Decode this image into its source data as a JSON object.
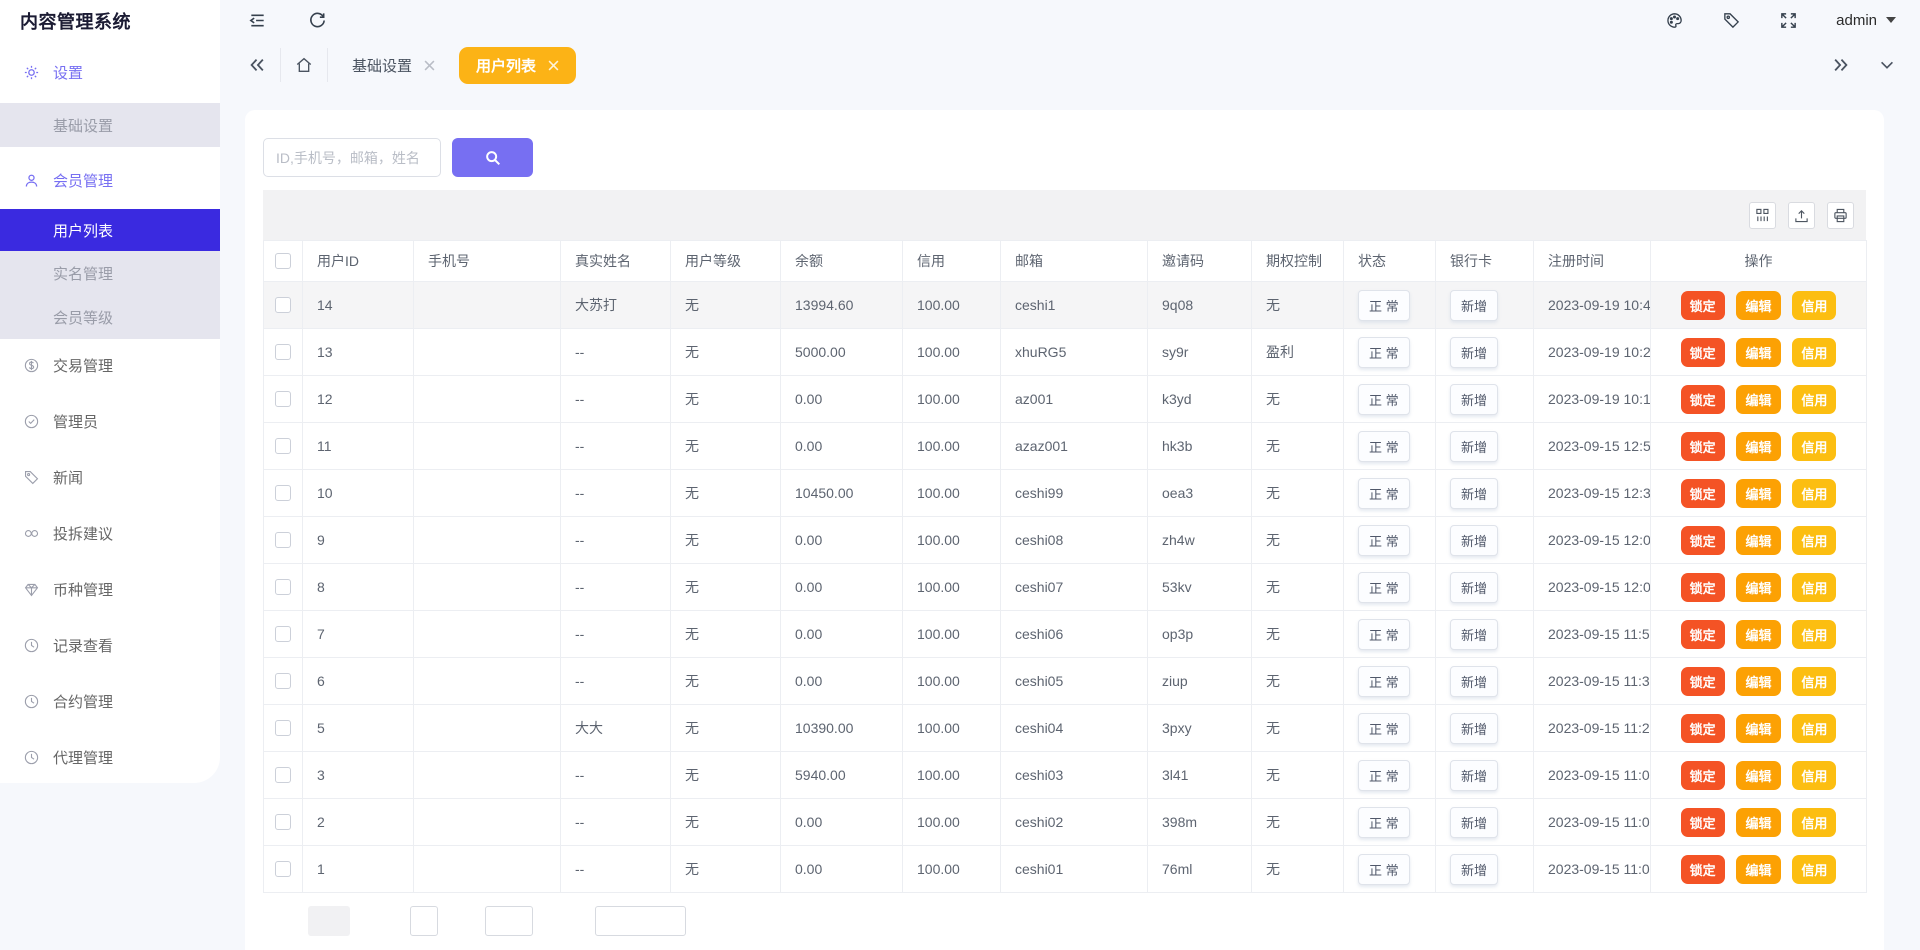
{
  "app": {
    "title": "内容管理系统"
  },
  "topbar": {
    "icons": [
      "menu-fold-icon",
      "refresh-icon",
      "palette-icon",
      "tag-icon",
      "fullscreen-icon"
    ],
    "user": "admin"
  },
  "tabs": {
    "collapse_icon": "double-chevron-left",
    "home_icon": "home-icon",
    "items": [
      {
        "label": "基础设置",
        "active": false
      },
      {
        "label": "用户列表",
        "active": true
      }
    ],
    "more_icon": "double-chevron-right",
    "dropdown_icon": "chevron-down"
  },
  "sidebar": {
    "items": [
      {
        "label": "设置",
        "icon": "gear-icon"
      },
      {
        "label": "基础设置"
      },
      {
        "label": "会员管理",
        "icon": "user-icon"
      },
      {
        "label": "用户列表",
        "selected": true
      },
      {
        "label": "实名管理"
      },
      {
        "label": "会员等级"
      },
      {
        "label": "交易管理",
        "icon": "dollar-icon"
      },
      {
        "label": "管理员",
        "icon": "shield-check-icon"
      },
      {
        "label": "新闻",
        "icon": "tag-icon"
      },
      {
        "label": "投拆建议",
        "icon": "link-icon"
      },
      {
        "label": "币种管理",
        "icon": "gem-icon"
      },
      {
        "label": "记录查看",
        "icon": "clock-icon"
      },
      {
        "label": "合约管理",
        "icon": "clock-icon"
      },
      {
        "label": "代理管理",
        "icon": "clock-icon"
      }
    ]
  },
  "search": {
    "placeholder": "ID,手机号，邮箱，姓名"
  },
  "table": {
    "toolbar_icons": [
      "columns-icon",
      "export-icon",
      "print-icon"
    ],
    "headers": [
      "用户ID",
      "手机号",
      "真实姓名",
      "用户等级",
      "余额",
      "信用",
      "邮箱",
      "邀请码",
      "期权控制",
      "状态",
      "银行卡",
      "注册时间",
      "操作"
    ],
    "actions": [
      "锁定",
      "编辑",
      "信用"
    ],
    "rows": [
      {
        "user_id": "14",
        "phone": "",
        "real_name": "大苏打",
        "level": "无",
        "balance": "13994.60",
        "credit": "100.00",
        "email": "ceshi1",
        "invite_code": "9q08",
        "option_control": "无",
        "status": "正 常",
        "bank": "新增",
        "reg_time": "2023-09-19 10:4"
      },
      {
        "user_id": "13",
        "phone": "",
        "real_name": "--",
        "level": "无",
        "balance": "5000.00",
        "credit": "100.00",
        "email": "xhuRG5",
        "invite_code": "sy9r",
        "option_control": "盈利",
        "status": "正 常",
        "bank": "新增",
        "reg_time": "2023-09-19 10:2"
      },
      {
        "user_id": "12",
        "phone": "",
        "real_name": "--",
        "level": "无",
        "balance": "0.00",
        "credit": "100.00",
        "email": "az001",
        "invite_code": "k3yd",
        "option_control": "无",
        "status": "正 常",
        "bank": "新增",
        "reg_time": "2023-09-19 10:1"
      },
      {
        "user_id": "11",
        "phone": "",
        "real_name": "--",
        "level": "无",
        "balance": "0.00",
        "credit": "100.00",
        "email": "azaz001",
        "invite_code": "hk3b",
        "option_control": "无",
        "status": "正 常",
        "bank": "新增",
        "reg_time": "2023-09-15 12:5"
      },
      {
        "user_id": "10",
        "phone": "",
        "real_name": "--",
        "level": "无",
        "balance": "10450.00",
        "credit": "100.00",
        "email": "ceshi99",
        "invite_code": "oea3",
        "option_control": "无",
        "status": "正 常",
        "bank": "新增",
        "reg_time": "2023-09-15 12:3"
      },
      {
        "user_id": "9",
        "phone": "",
        "real_name": "--",
        "level": "无",
        "balance": "0.00",
        "credit": "100.00",
        "email": "ceshi08",
        "invite_code": "zh4w",
        "option_control": "无",
        "status": "正 常",
        "bank": "新增",
        "reg_time": "2023-09-15 12:0"
      },
      {
        "user_id": "8",
        "phone": "",
        "real_name": "--",
        "level": "无",
        "balance": "0.00",
        "credit": "100.00",
        "email": "ceshi07",
        "invite_code": "53kv",
        "option_control": "无",
        "status": "正 常",
        "bank": "新增",
        "reg_time": "2023-09-15 12:0"
      },
      {
        "user_id": "7",
        "phone": "",
        "real_name": "--",
        "level": "无",
        "balance": "0.00",
        "credit": "100.00",
        "email": "ceshi06",
        "invite_code": "op3p",
        "option_control": "无",
        "status": "正 常",
        "bank": "新增",
        "reg_time": "2023-09-15 11:5"
      },
      {
        "user_id": "6",
        "phone": "",
        "real_name": "--",
        "level": "无",
        "balance": "0.00",
        "credit": "100.00",
        "email": "ceshi05",
        "invite_code": "ziup",
        "option_control": "无",
        "status": "正 常",
        "bank": "新增",
        "reg_time": "2023-09-15 11:3"
      },
      {
        "user_id": "5",
        "phone": "",
        "real_name": "大大",
        "level": "无",
        "balance": "10390.00",
        "credit": "100.00",
        "email": "ceshi04",
        "invite_code": "3pxy",
        "option_control": "无",
        "status": "正 常",
        "bank": "新增",
        "reg_time": "2023-09-15 11:2"
      },
      {
        "user_id": "3",
        "phone": "",
        "real_name": "--",
        "level": "无",
        "balance": "5940.00",
        "credit": "100.00",
        "email": "ceshi03",
        "invite_code": "3l41",
        "option_control": "无",
        "status": "正 常",
        "bank": "新增",
        "reg_time": "2023-09-15 11:0"
      },
      {
        "user_id": "2",
        "phone": "",
        "real_name": "--",
        "level": "无",
        "balance": "0.00",
        "credit": "100.00",
        "email": "ceshi02",
        "invite_code": "398m",
        "option_control": "无",
        "status": "正 常",
        "bank": "新增",
        "reg_time": "2023-09-15 11:0"
      },
      {
        "user_id": "1",
        "phone": "",
        "real_name": "--",
        "level": "无",
        "balance": "0.00",
        "credit": "100.00",
        "email": "ceshi01",
        "invite_code": "76ml",
        "option_control": "无",
        "status": "正 常",
        "bank": "新增",
        "reg_time": "2023-09-15 11:0"
      }
    ]
  },
  "colors": {
    "accent": "#776ff2",
    "sidebar_active_bg": "#3a2ae0",
    "tab_active_bg": "#fcb316",
    "action_lock": "#f45325",
    "action_edit": "#fca104",
    "action_credit": "#fcbe11",
    "toolbar_bg": "#f2f2f3",
    "highlight_row_bg": "#f5f5f6"
  }
}
